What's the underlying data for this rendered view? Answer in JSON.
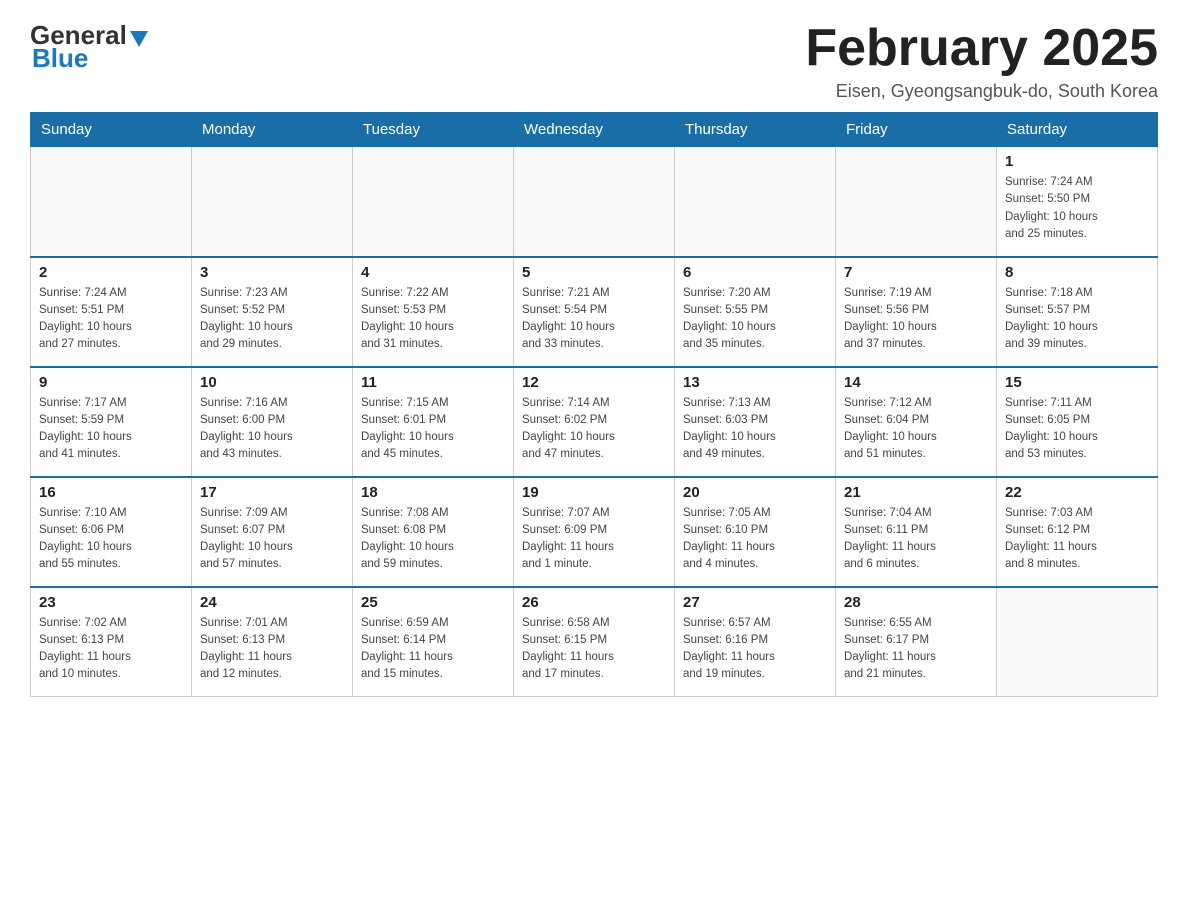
{
  "header": {
    "logo_general": "General",
    "logo_blue": "Blue",
    "month_title": "February 2025",
    "location": "Eisen, Gyeongsangbuk-do, South Korea"
  },
  "days_of_week": [
    "Sunday",
    "Monday",
    "Tuesday",
    "Wednesday",
    "Thursday",
    "Friday",
    "Saturday"
  ],
  "weeks": [
    {
      "days": [
        {
          "date": "",
          "info": ""
        },
        {
          "date": "",
          "info": ""
        },
        {
          "date": "",
          "info": ""
        },
        {
          "date": "",
          "info": ""
        },
        {
          "date": "",
          "info": ""
        },
        {
          "date": "",
          "info": ""
        },
        {
          "date": "1",
          "info": "Sunrise: 7:24 AM\nSunset: 5:50 PM\nDaylight: 10 hours\nand 25 minutes."
        }
      ]
    },
    {
      "days": [
        {
          "date": "2",
          "info": "Sunrise: 7:24 AM\nSunset: 5:51 PM\nDaylight: 10 hours\nand 27 minutes."
        },
        {
          "date": "3",
          "info": "Sunrise: 7:23 AM\nSunset: 5:52 PM\nDaylight: 10 hours\nand 29 minutes."
        },
        {
          "date": "4",
          "info": "Sunrise: 7:22 AM\nSunset: 5:53 PM\nDaylight: 10 hours\nand 31 minutes."
        },
        {
          "date": "5",
          "info": "Sunrise: 7:21 AM\nSunset: 5:54 PM\nDaylight: 10 hours\nand 33 minutes."
        },
        {
          "date": "6",
          "info": "Sunrise: 7:20 AM\nSunset: 5:55 PM\nDaylight: 10 hours\nand 35 minutes."
        },
        {
          "date": "7",
          "info": "Sunrise: 7:19 AM\nSunset: 5:56 PM\nDaylight: 10 hours\nand 37 minutes."
        },
        {
          "date": "8",
          "info": "Sunrise: 7:18 AM\nSunset: 5:57 PM\nDaylight: 10 hours\nand 39 minutes."
        }
      ]
    },
    {
      "days": [
        {
          "date": "9",
          "info": "Sunrise: 7:17 AM\nSunset: 5:59 PM\nDaylight: 10 hours\nand 41 minutes."
        },
        {
          "date": "10",
          "info": "Sunrise: 7:16 AM\nSunset: 6:00 PM\nDaylight: 10 hours\nand 43 minutes."
        },
        {
          "date": "11",
          "info": "Sunrise: 7:15 AM\nSunset: 6:01 PM\nDaylight: 10 hours\nand 45 minutes."
        },
        {
          "date": "12",
          "info": "Sunrise: 7:14 AM\nSunset: 6:02 PM\nDaylight: 10 hours\nand 47 minutes."
        },
        {
          "date": "13",
          "info": "Sunrise: 7:13 AM\nSunset: 6:03 PM\nDaylight: 10 hours\nand 49 minutes."
        },
        {
          "date": "14",
          "info": "Sunrise: 7:12 AM\nSunset: 6:04 PM\nDaylight: 10 hours\nand 51 minutes."
        },
        {
          "date": "15",
          "info": "Sunrise: 7:11 AM\nSunset: 6:05 PM\nDaylight: 10 hours\nand 53 minutes."
        }
      ]
    },
    {
      "days": [
        {
          "date": "16",
          "info": "Sunrise: 7:10 AM\nSunset: 6:06 PM\nDaylight: 10 hours\nand 55 minutes."
        },
        {
          "date": "17",
          "info": "Sunrise: 7:09 AM\nSunset: 6:07 PM\nDaylight: 10 hours\nand 57 minutes."
        },
        {
          "date": "18",
          "info": "Sunrise: 7:08 AM\nSunset: 6:08 PM\nDaylight: 10 hours\nand 59 minutes."
        },
        {
          "date": "19",
          "info": "Sunrise: 7:07 AM\nSunset: 6:09 PM\nDaylight: 11 hours\nand 1 minute."
        },
        {
          "date": "20",
          "info": "Sunrise: 7:05 AM\nSunset: 6:10 PM\nDaylight: 11 hours\nand 4 minutes."
        },
        {
          "date": "21",
          "info": "Sunrise: 7:04 AM\nSunset: 6:11 PM\nDaylight: 11 hours\nand 6 minutes."
        },
        {
          "date": "22",
          "info": "Sunrise: 7:03 AM\nSunset: 6:12 PM\nDaylight: 11 hours\nand 8 minutes."
        }
      ]
    },
    {
      "days": [
        {
          "date": "23",
          "info": "Sunrise: 7:02 AM\nSunset: 6:13 PM\nDaylight: 11 hours\nand 10 minutes."
        },
        {
          "date": "24",
          "info": "Sunrise: 7:01 AM\nSunset: 6:13 PM\nDaylight: 11 hours\nand 12 minutes."
        },
        {
          "date": "25",
          "info": "Sunrise: 6:59 AM\nSunset: 6:14 PM\nDaylight: 11 hours\nand 15 minutes."
        },
        {
          "date": "26",
          "info": "Sunrise: 6:58 AM\nSunset: 6:15 PM\nDaylight: 11 hours\nand 17 minutes."
        },
        {
          "date": "27",
          "info": "Sunrise: 6:57 AM\nSunset: 6:16 PM\nDaylight: 11 hours\nand 19 minutes."
        },
        {
          "date": "28",
          "info": "Sunrise: 6:55 AM\nSunset: 6:17 PM\nDaylight: 11 hours\nand 21 minutes."
        },
        {
          "date": "",
          "info": ""
        }
      ]
    }
  ]
}
